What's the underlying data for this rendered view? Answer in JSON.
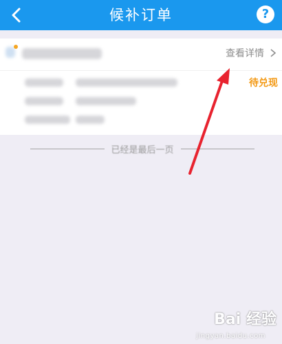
{
  "header": {
    "title": "候补订单",
    "back_icon": "chevron-left-icon",
    "help_label": "?",
    "help_icon": "help-icon"
  },
  "order": {
    "view_details_label": "查看详情",
    "status": "待兑现",
    "chevron_icon": "chevron-right-icon"
  },
  "list_end_text": "已经是最后一页",
  "watermark": {
    "text": "Bai 经验",
    "url": "jingyan.baidu.com"
  },
  "colors": {
    "header_bg": "#1a98ee",
    "page_bg": "#efedf5",
    "status_orange": "#f39a17",
    "arrow_red": "#e8232f"
  }
}
